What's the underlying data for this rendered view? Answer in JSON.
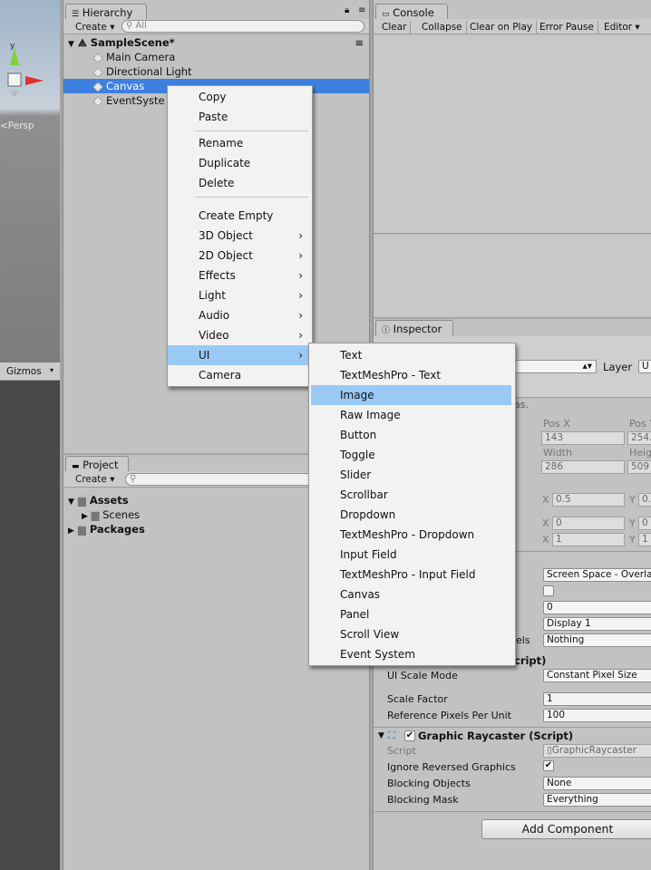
{
  "scene_view": {
    "persp_label": "<Persp",
    "axis_y": "y",
    "gizmos_label": "Gizmos"
  },
  "hierarchy": {
    "tab": "Hierarchy",
    "create_label": "Create",
    "search_placeholder": "All",
    "scene_name": "SampleScene*",
    "items": [
      "Main Camera",
      "Directional Light",
      "Canvas",
      "EventSyste"
    ]
  },
  "context_menu": {
    "items": [
      "Copy",
      "Paste",
      "Rename",
      "Duplicate",
      "Delete",
      "Create Empty",
      "3D Object",
      "2D Object",
      "Effects",
      "Light",
      "Audio",
      "Video",
      "UI",
      "Camera"
    ]
  },
  "ui_submenu": {
    "items": [
      "Text",
      "TextMeshPro - Text",
      "Image",
      "Raw Image",
      "Button",
      "Toggle",
      "Slider",
      "Scrollbar",
      "Dropdown",
      "TextMeshPro - Dropdown",
      "Input Field",
      "TextMeshPro - Input Field",
      "Canvas",
      "Panel",
      "Scroll View",
      "Event System"
    ],
    "highlighted": "Image"
  },
  "console": {
    "tab": "Console",
    "buttons": [
      "Clear",
      "Collapse",
      "Clear on Play",
      "Error Pause",
      "Editor"
    ]
  },
  "project": {
    "tab": "Project",
    "create_label": "Create",
    "tree": [
      "Assets",
      "Scenes",
      "Packages"
    ]
  },
  "inspector": {
    "tab": "Inspector",
    "layer_label": "Layer",
    "layer_value": "U",
    "note_tail": "as.",
    "pos_x_label": "Pos X",
    "pos_y_label": "Pos Y",
    "pos_x": "143",
    "pos_y": "254.",
    "width_label": "Width",
    "height_label": "Heigh",
    "width": "286",
    "height": "509",
    "anchor_min_x": "0.5",
    "anchor_min_y": "0.",
    "anchor_max_x": "0",
    "anchor_max_y": "0",
    "pivot_x": "1",
    "pivot_y": "1",
    "x_lbl": "X",
    "y_lbl": "Y",
    "render_mode": "Screen Space - Overla",
    "sort_order": "0",
    "target_display": "Display 1",
    "channels_label_tail": "els",
    "channels_value": "Nothing",
    "scaler_title_tail": "cript)",
    "ui_scale_mode_label": "UI Scale Mode",
    "ui_scale_mode_value": "Constant Pixel Size",
    "scale_factor_label": "Scale Factor",
    "scale_factor_value": "1",
    "ref_ppu_label": "Reference Pixels Per Unit",
    "ref_ppu_value": "100",
    "raycaster_title": "Graphic Raycaster (Script)",
    "script_label": "Script",
    "script_value": "GraphicRaycaster",
    "ignore_reversed_label": "Ignore Reversed Graphics",
    "blocking_objects_label": "Blocking Objects",
    "blocking_objects_value": "None",
    "blocking_mask_label": "Blocking Mask",
    "blocking_mask_value": "Everything",
    "add_component": "Add Component"
  }
}
